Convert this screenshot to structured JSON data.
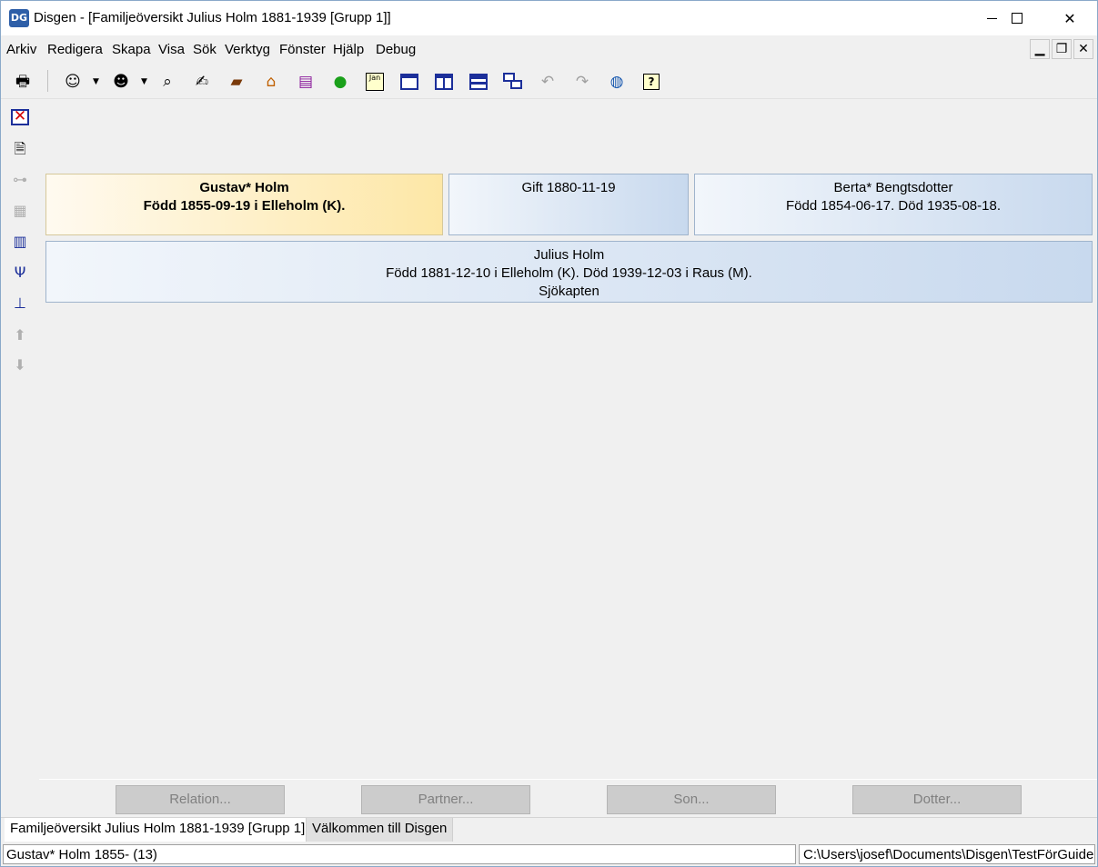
{
  "window": {
    "title": "Disgen - [Familjeöversikt Julius Holm 1881-1939 [Grupp 1]]",
    "app_icon_text": "DG"
  },
  "menu": {
    "items": [
      {
        "label": "Arkiv"
      },
      {
        "label": "Redigera"
      },
      {
        "label": "Skapa"
      },
      {
        "label": "Visa"
      },
      {
        "label": "Sök"
      },
      {
        "label": "Verktyg"
      },
      {
        "label": "Fönster"
      },
      {
        "label": "Hjälp"
      },
      {
        "label": "Debug"
      }
    ]
  },
  "toolbar": {
    "icons": [
      "printer-icon",
      "person-icon",
      "person-search-icon",
      "binoculars-icon",
      "handshake-icon",
      "book-icon",
      "house-icon",
      "books-icon",
      "map-icon",
      "calendar-icon",
      "window-icon",
      "window-vsplit-icon",
      "window-hsplit-icon",
      "window-cascade-icon",
      "undo-icon",
      "redo-icon",
      "globe-icon",
      "help-icon"
    ],
    "calendar_label": "Jan"
  },
  "sidebar": {
    "icons": [
      "close-view-icon",
      "document-edit-icon",
      "tree-icon",
      "sheet-icon",
      "columns-icon",
      "ancestors-icon",
      "descendants-icon",
      "up-icon",
      "down-icon"
    ]
  },
  "family": {
    "husband": {
      "name": "Gustav* Holm",
      "details": "Född 1855-09-19 i Elleholm (K)."
    },
    "marriage": {
      "text": "Gift 1880-11-19"
    },
    "wife": {
      "name": "Berta* Bengtsdotter",
      "details": "Född 1854-06-17. Död 1935-08-18."
    },
    "child": {
      "name": "Julius Holm",
      "details": "Född 1881-12-10 i Elleholm (K). Död 1939-12-03 i Raus (M).",
      "occupation": "Sjökapten"
    }
  },
  "actions": {
    "relation": "Relation...",
    "partner": "Partner...",
    "son": "Son...",
    "dotter": "Dotter..."
  },
  "tabs": {
    "active": "Familjeöversikt Julius Holm 1881-1939 [Grupp 1]",
    "inactive": "Välkommen till Disgen"
  },
  "status": {
    "left": "Gustav* Holm 1855- (13)",
    "right": "C:\\Users\\josef\\Documents\\Disgen\\TestFörGuide"
  }
}
